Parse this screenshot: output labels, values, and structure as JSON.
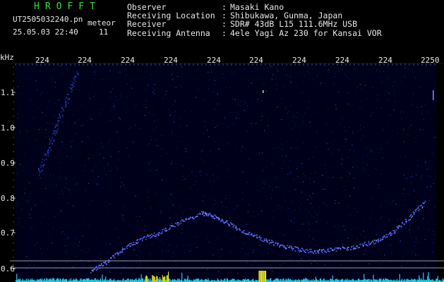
{
  "header": {
    "app_title": "HROFFT",
    "file_name": "UT2505032240.pn",
    "file_sub": "meteor",
    "datetime": "25.05.03 22:40",
    "count": "11",
    "info": [
      {
        "label": "Observer",
        "value": "Masaki Kano"
      },
      {
        "label": "Receiving Location",
        "value": "Shibukawa, Gunma, Japan"
      },
      {
        "label": "Receiver",
        "value": "SDR# 43dB L15 111.6MHz USB"
      },
      {
        "label": "Receiving Antenna",
        "value": "4ele Yagi Az 230 for Kansai VOR"
      }
    ]
  },
  "axes": {
    "y_unit": "kHz",
    "x_tick_labels": [
      "224",
      "224",
      "224",
      "224",
      "224",
      "224",
      "224",
      "224",
      "224",
      "2250"
    ],
    "y_tick_labels": [
      "1.1",
      "1.0",
      "0.9",
      "0.8",
      "0.7",
      "0.6"
    ]
  },
  "colors": {
    "background": "#000000",
    "plot_bg": "#00001a",
    "signal": "#4f66ff",
    "title_green": "#37e037",
    "text": "#e8e8e8",
    "level_cyan": "#20e0ff",
    "level_yellow": "#e8e820"
  }
}
